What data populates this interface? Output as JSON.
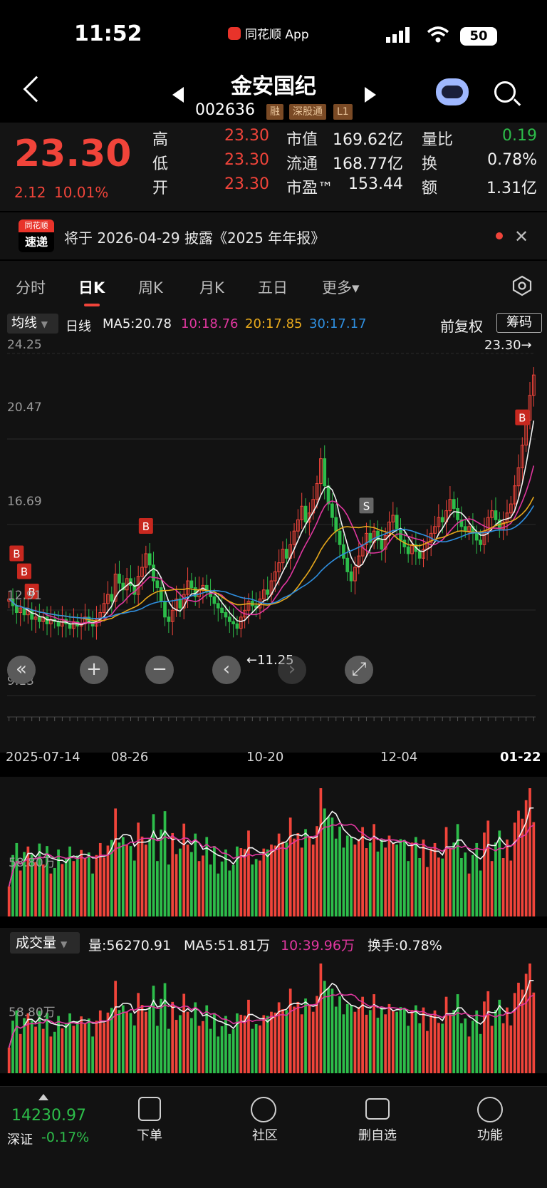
{
  "status_bar": {
    "time": "11:52",
    "app_name": "同花顺 App",
    "battery": "50"
  },
  "header": {
    "stock_name": "金安国纪",
    "stock_code": "002636",
    "tags": [
      "融",
      "深股通",
      "L1"
    ]
  },
  "quote": {
    "price": "23.30",
    "change": "2.12",
    "change_pct": "10.01%",
    "fields": [
      {
        "label": "高",
        "value": "23.30",
        "color": "#f0443a"
      },
      {
        "label": "低",
        "value": "23.30",
        "color": "#f0443a"
      },
      {
        "label": "开",
        "value": "23.30",
        "color": "#f0443a"
      },
      {
        "label": "市值",
        "value": "169.62亿",
        "color": "#f2f2f2"
      },
      {
        "label": "流通",
        "value": "168.77亿",
        "color": "#f2f2f2"
      },
      {
        "label": "市盈™",
        "value": "153.44",
        "color": "#f2f2f2"
      },
      {
        "label": "量比",
        "value": "0.19",
        "color": "#2dbd4a"
      },
      {
        "label": "换",
        "value": "0.78%",
        "color": "#f2f2f2"
      },
      {
        "label": "额",
        "value": "1.31亿",
        "color": "#f2f2f2"
      }
    ]
  },
  "notice": {
    "badge_top": "同花顺",
    "badge_bottom": "速递",
    "text": "将于 2026-04-29 披露《2025 年年报》"
  },
  "tabs": [
    "分时",
    "日K",
    "周K",
    "月K",
    "五日",
    "更多▾"
  ],
  "ma_bar": {
    "indicator": "均线",
    "period": "日线",
    "ma5": "MA5:20.78",
    "ma10": "10:18.76",
    "ma20": "20:17.85",
    "ma30": "30:17.17",
    "adjust": "前复权",
    "chips_button": "筹码"
  },
  "colors": {
    "up": "#f0443a",
    "down": "#2dbd4a",
    "ma5": "#f2f2f2",
    "ma10": "#e0379f",
    "ma20": "#e8a91c",
    "ma30": "#2f8fe0"
  },
  "chart_data": {
    "type": "candlestick",
    "y_ticks": [
      "24.25",
      "20.47",
      "16.69",
      "12.91",
      "9.13"
    ],
    "ylim": [
      9.13,
      24.25
    ],
    "x_ticks": [
      "2025-07-14",
      "08-26",
      "10-20",
      "12-04",
      "01-22"
    ],
    "last_price_marker": "23.30→",
    "min_marker": "←11.25",
    "signals": [
      "B",
      "B",
      "B",
      "B",
      "S",
      "B"
    ],
    "closes": [
      13.4,
      13.1,
      12.8,
      13.0,
      12.7,
      12.9,
      12.5,
      12.6,
      12.4,
      12.6,
      12.3,
      12.5,
      12.4,
      12.2,
      12.5,
      12.3,
      12.1,
      12.4,
      12.2,
      12.3,
      12.6,
      12.4,
      12.2,
      12.5,
      12.8,
      13.2,
      13.6,
      13.3,
      14.5,
      14.1,
      13.8,
      14.3,
      14.0,
      13.6,
      14.4,
      14.8,
      15.4,
      14.9,
      14.2,
      13.9,
      13.3,
      12.6,
      12.4,
      12.9,
      13.4,
      13.0,
      13.6,
      14.2,
      13.9,
      13.5,
      13.8,
      14.0,
      13.7,
      13.5,
      13.2,
      13.0,
      12.8,
      12.6,
      12.4,
      12.3,
      12.1,
      12.6,
      12.9,
      13.3,
      13.1,
      13.0,
      13.4,
      13.8,
      13.6,
      14.2,
      14.6,
      15.0,
      15.6,
      15.2,
      15.8,
      16.4,
      16.9,
      17.5,
      16.8,
      17.2,
      17.8,
      18.5,
      19.6,
      18.4,
      17.6,
      17.0,
      16.4,
      15.8,
      15.2,
      14.6,
      14.2,
      14.8,
      15.3,
      15.8,
      16.3,
      15.9,
      16.4,
      16.0,
      15.6,
      16.2,
      16.8,
      17.1,
      16.5,
      16.0,
      15.7,
      15.4,
      15.8,
      15.5,
      15.2,
      15.6,
      15.9,
      16.3,
      16.6,
      17.0,
      16.8,
      17.3,
      17.8,
      17.4,
      16.9,
      16.6,
      16.4,
      16.6,
      16.3,
      16.0,
      15.8,
      16.4,
      17.0,
      17.3,
      16.9,
      16.5,
      16.8,
      17.2,
      17.6,
      18.4,
      19.2,
      20.2,
      21.3,
      22.4,
      23.3
    ]
  },
  "controls": [
    "«",
    "+",
    "−",
    "‹",
    "›",
    "⤢"
  ],
  "volume": {
    "indicator": "成交量",
    "vol": "量:56270.91",
    "ma5": "MA5:51.81万",
    "ma10": "10:39.96万",
    "turnover": "换手:0.78%",
    "level_label": "58.80万"
  },
  "bottom_bar": {
    "index_value": "14230.97",
    "index_name": "深证",
    "index_change": "-0.17%",
    "items": [
      "下单",
      "社区",
      "删自选",
      "功能"
    ]
  }
}
